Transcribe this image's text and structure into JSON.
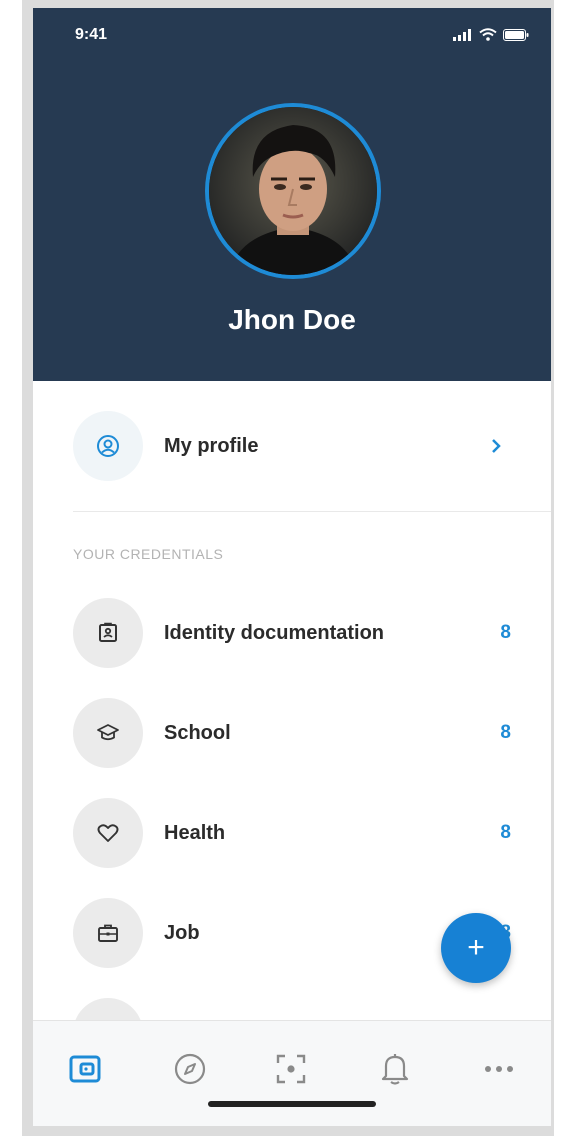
{
  "status_bar": {
    "time": "9:41"
  },
  "profile": {
    "name": "Jhon Doe"
  },
  "my_profile": {
    "label": "My profile"
  },
  "credentials": {
    "section_title": "YOUR CREDENTIALS",
    "items": [
      {
        "label": "Identity documentation",
        "count": "8",
        "icon": "id-card-icon"
      },
      {
        "label": "School",
        "count": "8",
        "icon": "graduation-cap-icon"
      },
      {
        "label": "Health",
        "count": "8",
        "icon": "heart-icon"
      },
      {
        "label": "Job",
        "count": "8",
        "icon": "briefcase-icon"
      }
    ]
  },
  "fab": {
    "label": "+"
  },
  "tabs": [
    {
      "name": "wallet",
      "icon": "wallet-icon",
      "active": true
    },
    {
      "name": "explore",
      "icon": "compass-icon",
      "active": false
    },
    {
      "name": "scan",
      "icon": "scan-icon",
      "active": false
    },
    {
      "name": "notifications",
      "icon": "bell-icon",
      "active": false
    },
    {
      "name": "more",
      "icon": "more-icon",
      "active": false
    }
  ],
  "colors": {
    "header_bg": "#263a52",
    "accent": "#1e8bd6",
    "fab": "#1781d4",
    "icon_bg": "#ebebeb"
  }
}
